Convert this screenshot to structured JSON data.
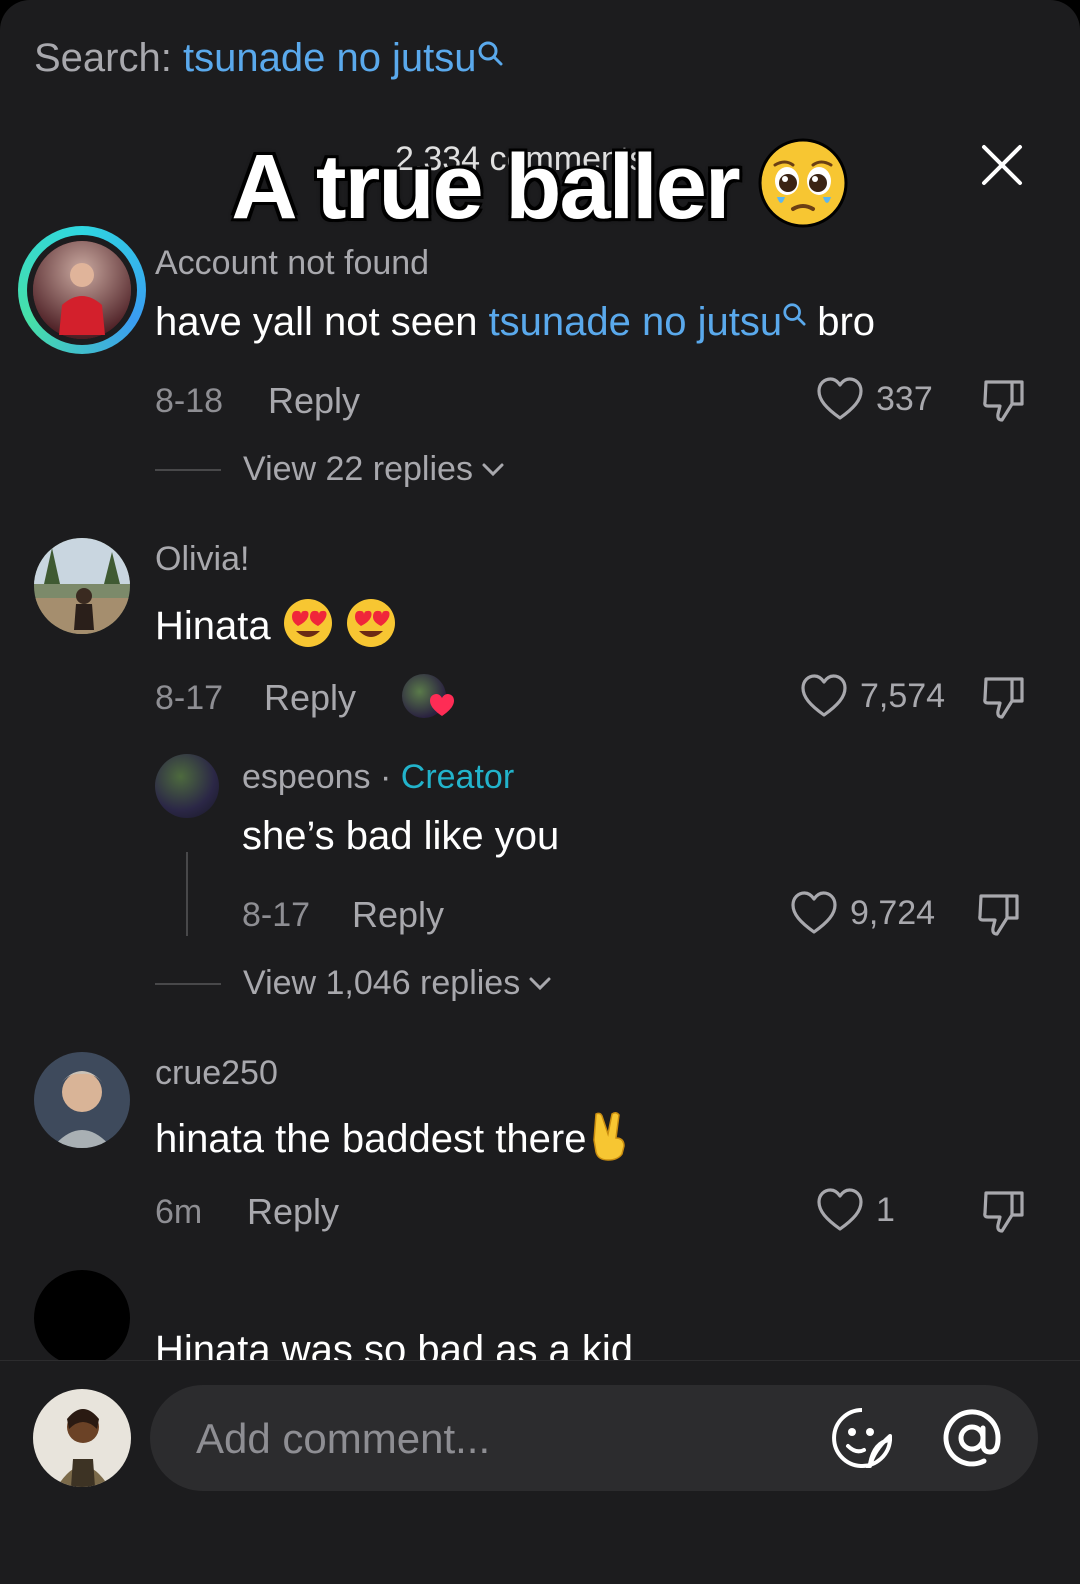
{
  "search": {
    "prefix": "Search:",
    "term": "tsunade no jutsu"
  },
  "header": {
    "comment_count": "2,334 comments"
  },
  "overlay": {
    "caption": "A true baller"
  },
  "comments": [
    {
      "username": "Account not found",
      "text_before": "have yall not seen ",
      "text_link": "tsunade no jutsu",
      "text_after": " bro",
      "date": "8-18",
      "reply_label": "Reply",
      "likes": "337",
      "view_replies": "View 22 replies"
    },
    {
      "username": "Olivia!",
      "text": "Hinata",
      "date": "8-17",
      "reply_label": "Reply",
      "likes": "7,574",
      "view_replies": "View 1,046 replies",
      "reply": {
        "username": "espeons",
        "separator": " · ",
        "badge": "Creator",
        "text": "she’s bad like you",
        "date": "8-17",
        "reply_label": "Reply",
        "likes": "9,724"
      }
    },
    {
      "username": "crue250",
      "text": "hinata the baddest there",
      "date": "6m",
      "reply_label": "Reply",
      "likes": "1"
    },
    {
      "text": "Hinata was so bad as a kid"
    }
  ],
  "composer": {
    "placeholder": "Add comment..."
  },
  "colors": {
    "link": "#5aa9ec",
    "creator": "#22b3cb",
    "background": "#1c1c1e",
    "heart": "#fe2c55"
  }
}
